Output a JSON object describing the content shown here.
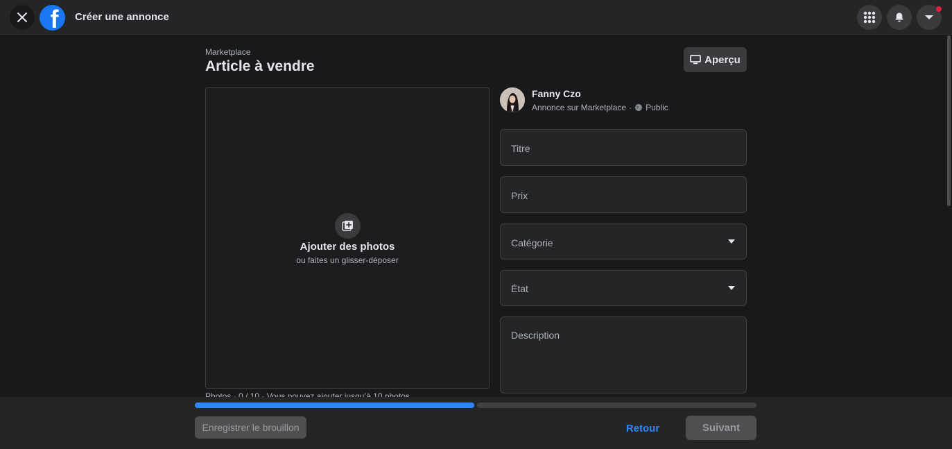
{
  "header": {
    "title": "Créer une annonce",
    "logo_letter": "f",
    "icons": [
      "close-icon",
      "facebook-logo",
      "menu-grid-icon",
      "bell-icon",
      "chevron-down-icon"
    ],
    "has_notification_dot": true
  },
  "page": {
    "breadcrumb": "Marketplace",
    "title": "Article à vendre",
    "preview_label": "Aperçu"
  },
  "photos": {
    "title": "Ajouter des photos",
    "subtitle": "ou faites un glisser-déposer",
    "count_text": "Photos · 0 / 10 - Vous pouvez ajouter jusqu’à 10 photos."
  },
  "user": {
    "name": "Fanny Czo",
    "listing_type": "Annonce sur Marketplace",
    "separator": "·",
    "audience": "Public"
  },
  "form": {
    "title_placeholder": "Titre",
    "price_placeholder": "Prix",
    "category_placeholder": "Catégorie",
    "condition_placeholder": "État",
    "description_placeholder": "Description"
  },
  "footer": {
    "step_progress": 0.5,
    "save_draft_label": "Enregistrer le brouillon",
    "back_label": "Retour",
    "next_label": "Suivant"
  },
  "colors": {
    "accent": "#2d88ff",
    "progress_active": "#2d88ff",
    "progress_inactive": "#3e4042",
    "background": "#18191a",
    "surface": "#242526"
  }
}
